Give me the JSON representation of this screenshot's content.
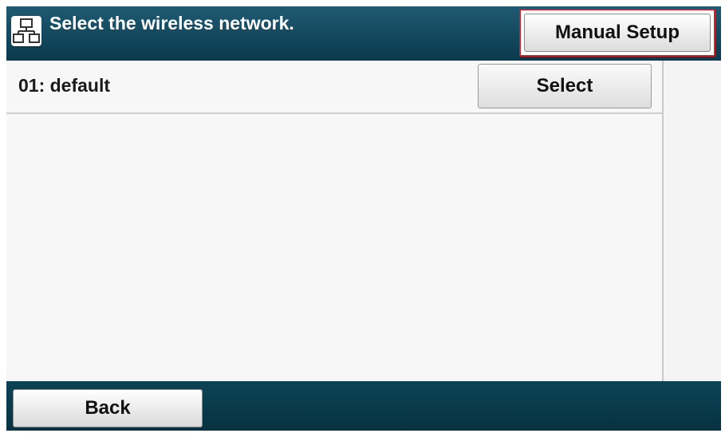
{
  "header": {
    "title": "Select the wireless network.",
    "icon": "network-icon",
    "manual_setup_label": "Manual Setup"
  },
  "networks": [
    {
      "label": "01: default",
      "select_label": "Select"
    }
  ],
  "footer": {
    "back_label": "Back"
  },
  "colors": {
    "header_bg": "#0a3a4d",
    "footer_bg": "#073242",
    "highlight_border": "#d0202a",
    "list_bg": "#f7f7f7"
  }
}
